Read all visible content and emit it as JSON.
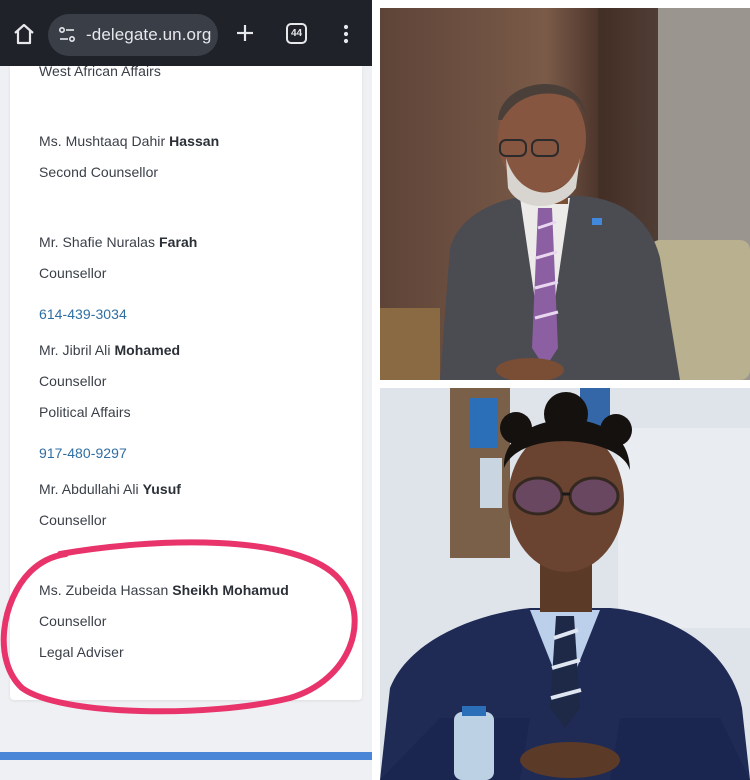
{
  "browser": {
    "url": "-delegate.un.org",
    "tab_count": "44",
    "icons": {
      "home": "home-icon",
      "site_info": "site-settings-icon",
      "new_tab": "plus-icon",
      "menu": "more-vert-icon"
    }
  },
  "directory": {
    "top_partial": "West African Affairs",
    "entries": [
      {
        "name_prefix": "Ms. Mushtaaq Dahir",
        "surname": "Hassan",
        "title": "Second Counsellor"
      },
      {
        "name_prefix": "Mr. Shafie Nuralas",
        "surname": "Farah",
        "title": "Counsellor",
        "phone": "614-439-3034"
      },
      {
        "name_prefix": "Mr. Jibril Ali",
        "surname": "Mohamed",
        "title": "Counsellor",
        "detail": "Political Affairs",
        "phone": "917-480-9297"
      },
      {
        "name_prefix": "Mr. Abdullahi Ali",
        "surname": "Yusuf",
        "title": "Counsellor"
      },
      {
        "name_prefix": "Ms. Zubeida Hassan",
        "surname": "Sheikh Mohamud",
        "title": "Counsellor",
        "detail": "Legal Adviser"
      }
    ]
  },
  "colors": {
    "browser_bar": "#1f2228",
    "link": "#2f6ea3",
    "highlight": "#e8336b",
    "bottom_strip": "#4a86d8"
  }
}
